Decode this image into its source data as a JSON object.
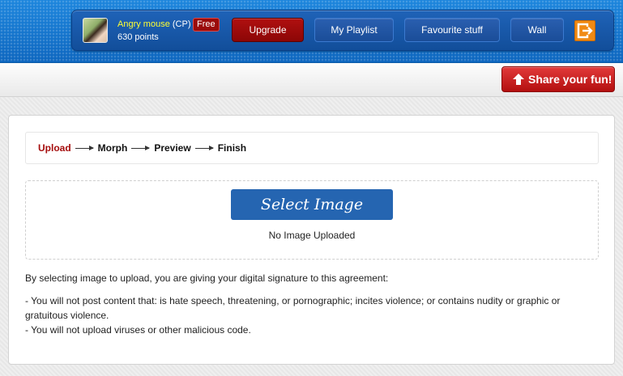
{
  "header": {
    "user": {
      "name": "Angry mouse",
      "role_tag": "(CP)",
      "badge": "Free",
      "points": "630 points"
    },
    "nav": [
      {
        "label": "Upgrade",
        "style": "red"
      },
      {
        "label": "My Playlist",
        "style": "blue"
      },
      {
        "label": "Favourite stuff",
        "style": "blue"
      },
      {
        "label": "Wall",
        "style": "blue"
      }
    ],
    "logout_icon": "logout-icon"
  },
  "subbar": {
    "share_label": "Share your fun!"
  },
  "wizard": {
    "steps": [
      "Upload",
      "Morph",
      "Preview",
      "Finish"
    ],
    "active_step": "Upload"
  },
  "upload": {
    "button_label": "Select Image",
    "status": "No Image Uploaded"
  },
  "agreement": {
    "intro": "By selecting image to upload, you are giving your digital signature to this agreement:",
    "terms": [
      "- You will not post content that: is hate speech, threatening, or pornographic; incites violence; or contains nudity or graphic or gratuitous violence.",
      "- You will not upload viruses or other malicious code."
    ]
  },
  "colors": {
    "header_blue": "#1a7fd6",
    "active_step": "#a50d0d",
    "select_button": "#2565b1",
    "share_red": "#c92020",
    "logout_orange": "#f08a14"
  }
}
